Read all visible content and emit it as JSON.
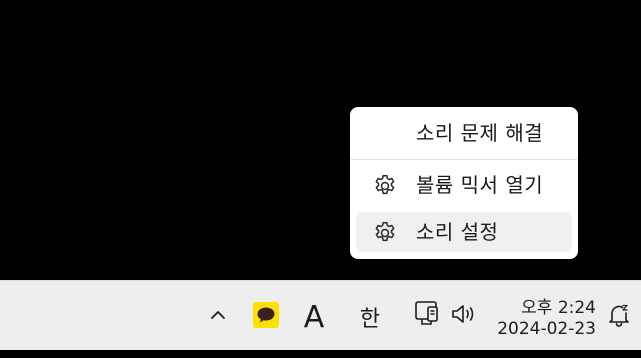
{
  "context_menu": {
    "items": [
      {
        "label": "소리 문제 해결",
        "icon": ""
      },
      {
        "label": "볼륨 믹서 열기",
        "icon": "gear-icon"
      },
      {
        "label": "소리 설정",
        "icon": "gear-icon",
        "highlighted": true
      }
    ]
  },
  "taskbar": {
    "tray_overflow_icon": "chevron-up-icon",
    "kakaotalk_icon": "kakaotalk-icon",
    "ime_mode_label": "A",
    "ime_language_label": "한",
    "network_icon": "ethernet-icon",
    "volume_icon": "speaker-icon",
    "clock": {
      "time": "오후 2:24",
      "date": "2024-02-23"
    },
    "notification_icon": "bell-snooze-icon"
  },
  "colors": {
    "desktop": "#000000",
    "menu_background": "#ffffff",
    "menu_highlight": "#f0f0f0",
    "taskbar_background": "#eeeeee",
    "kakao_yellow": "#fae100"
  }
}
